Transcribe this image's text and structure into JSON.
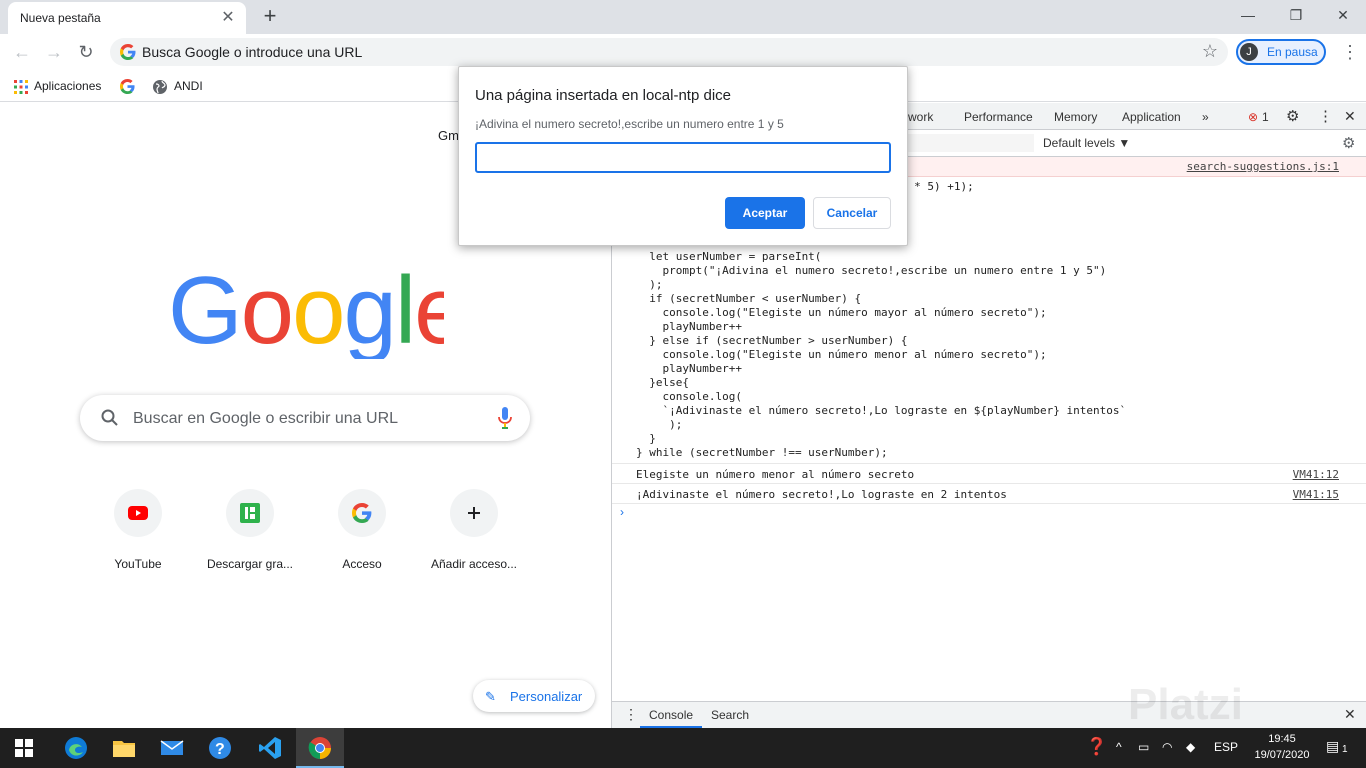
{
  "tab": {
    "title": "Nueva pestaña"
  },
  "omnibox": {
    "placeholder": "Busca Google o introduce una URL"
  },
  "profile": {
    "initial": "J",
    "label": "En pausa"
  },
  "bookmarks": [
    {
      "label": "Aplicaciones",
      "icon": "apps-grid-icon"
    },
    {
      "label": "",
      "icon": "google-g-icon"
    },
    {
      "label": "ANDI",
      "icon": "globe-icon"
    }
  ],
  "ntp": {
    "gmail": "Gm",
    "search_placeholder": "Buscar en Google o escribir una URL",
    "tiles": [
      {
        "label": "YouTube",
        "icon": "youtube-icon"
      },
      {
        "label": "Descargar gra...",
        "icon": "green-b-icon"
      },
      {
        "label": "Acceso",
        "icon": "google-g-icon"
      },
      {
        "label": "Añadir acceso...",
        "icon": "plus-icon"
      }
    ],
    "customize": "Personalizar"
  },
  "devtools": {
    "tabs": [
      "etwork",
      "Performance",
      "Memory",
      "Application"
    ],
    "error_count": "1",
    "default_levels": "Default levels ▼",
    "error_source": "search-suggestions.js:1",
    "code_lines": [
      "                                      m() * 5) +1);",
      "",
      "",
      "",
      "",
      "  let userNumber = parseInt(",
      "    prompt(\"¡Adivina el numero secreto!,escribe un numero entre 1 y 5\")",
      "  );",
      "  if (secretNumber < userNumber) {",
      "    console.log(\"Elegiste un número mayor al número secreto\");",
      "    playNumber++",
      "  } else if (secretNumber > userNumber) {",
      "    console.log(\"Elegiste un número menor al número secreto\");",
      "    playNumber++",
      "  }else{",
      "    console.log(",
      "    `¡Adivinaste el número secreto!,Lo lograste en ${playNumber} intentos`",
      "     );",
      "  }",
      "} while (secretNumber !== userNumber);"
    ],
    "logs": [
      {
        "text": "Elegiste un número menor al número secreto",
        "source": "VM41:12"
      },
      {
        "text": "¡Adivinaste el número secreto!,Lo lograste en 2 intentos",
        "source": "VM41:15"
      }
    ],
    "drawer_tabs": [
      "Console",
      "Search"
    ]
  },
  "dialog": {
    "title": "Una página insertada en local-ntp dice",
    "message": "¡Adivina el numero secreto!,escribe un numero entre 1 y 5",
    "input_value": "",
    "ok_label": "Aceptar",
    "cancel_label": "Cancelar"
  },
  "taskbar": {
    "lang": "ESP",
    "time": "19:45",
    "date": "19/07/2020",
    "notifications": "1"
  },
  "watermark": "Platzi",
  "colors": {
    "accent": "#1a73e8",
    "taskbar": "#1f1f1f"
  }
}
